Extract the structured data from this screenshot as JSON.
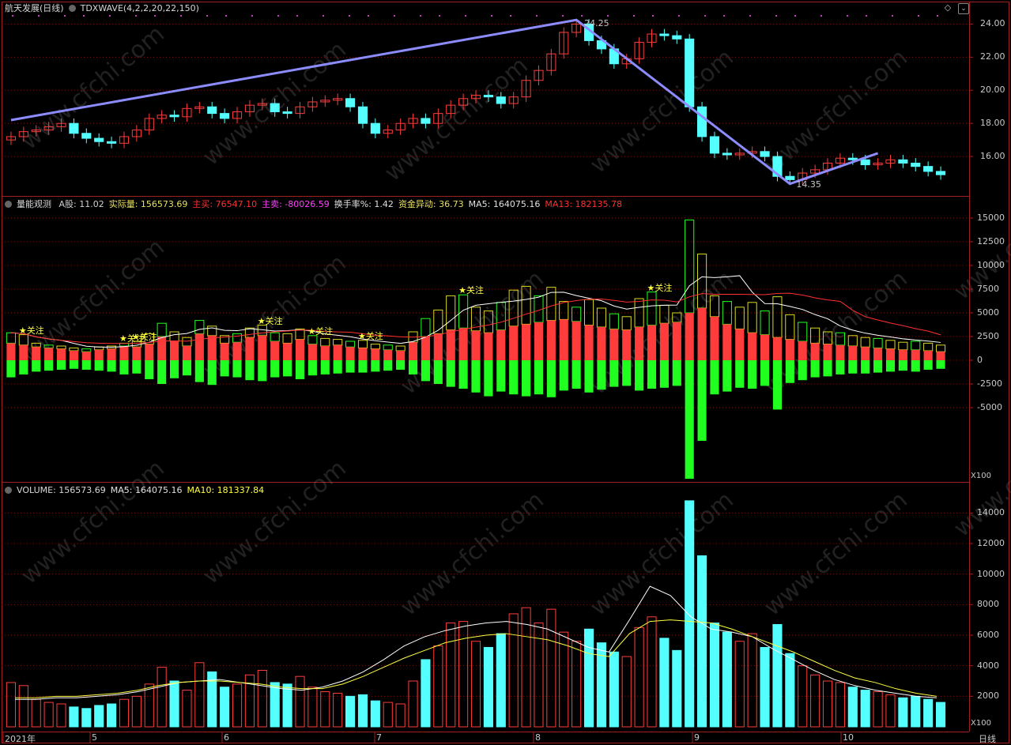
{
  "title": "航天发展(日线)",
  "indicator_name": "TDXWAVE(4,2,2,20,22,150)",
  "price_peak_label": "24.25",
  "price_trough_label": "14.35",
  "panel2": {
    "name": "量能观测",
    "items": [
      {
        "label": "A股: 11.02",
        "color": "#d0d0d0"
      },
      {
        "label": "实际量: 156573.69",
        "color": "#e8e060"
      },
      {
        "label": "主买: 76547.10",
        "color": "#ff3030"
      },
      {
        "label": "主卖: -80026.59",
        "color": "#ff40ff"
      },
      {
        "label": "换手率%: 1.42",
        "color": "#e0e0e0"
      },
      {
        "label": "资金异动: 36.73",
        "color": "#e8e060"
      },
      {
        "label": "MA5: 164075.16",
        "color": "#e0e0e0"
      },
      {
        "label": "MA13: 182135.78",
        "color": "#ff3030"
      }
    ],
    "marker": "关注",
    "unit": "X100"
  },
  "panel3": {
    "name": "VOLUME: 156573.69",
    "ma5": "MA5: 164075.16",
    "ma10": "MA10: 181337.84",
    "unit": "X100"
  },
  "period_label": "日线",
  "colors": {
    "up": "#ff3c3c",
    "down": "#54ffff",
    "wave": "#8c8cff",
    "ma5": "#ffffff",
    "ma10": "#ffff40",
    "ma13": "#ff3030",
    "green": "#20ff20"
  },
  "chart_data": [
    {
      "type": "candlestick",
      "title": "航天发展(日线)",
      "y_ticks": [
        "24.00",
        "22.00",
        "20.00",
        "18.00",
        "16.00"
      ],
      "ylim": [
        14.0,
        24.5
      ],
      "x_ticks": [
        "2021年",
        "5",
        "6",
        "7",
        "8",
        "9",
        "10"
      ],
      "peak": 24.25,
      "trough": 14.35,
      "close_path": [
        17.2,
        17.5,
        17.6,
        17.8,
        18.0,
        17.4,
        17.1,
        16.9,
        16.8,
        17.2,
        17.6,
        18.3,
        18.5,
        18.4,
        18.9,
        19.0,
        18.6,
        18.3,
        18.7,
        19.1,
        19.2,
        18.7,
        18.6,
        19.0,
        19.3,
        19.4,
        19.5,
        19.0,
        18.0,
        17.4,
        17.6,
        18.0,
        18.3,
        18.0,
        18.6,
        19.1,
        19.5,
        19.7,
        19.6,
        19.2,
        19.6,
        20.6,
        21.2,
        22.2,
        23.5,
        24.0,
        23.0,
        22.5,
        21.6,
        21.9,
        22.9,
        23.4,
        23.3,
        23.1,
        19.0,
        17.2,
        16.2,
        16.1,
        16.2,
        16.3,
        16.0,
        14.8,
        14.6,
        15.0,
        15.2,
        15.6,
        15.9,
        15.8,
        15.5,
        15.6,
        15.8,
        15.6,
        15.4,
        15.1,
        14.9
      ]
    },
    {
      "type": "bar",
      "title": "量能观测",
      "y_ticks": [
        "15000",
        "12500",
        "10000",
        "7500",
        "5000",
        "2500",
        "0",
        "-2500",
        "-5000"
      ],
      "ylim": [
        -12500,
        15000
      ],
      "series": [
        {
          "name": "主买",
          "values": [
            1800,
            1600,
            1400,
            1300,
            1200,
            1000,
            900,
            1100,
            1200,
            1500,
            1400,
            1700,
            2500,
            2000,
            1500,
            2800,
            2600,
            1800,
            1900,
            2400,
            2600,
            2000,
            1800,
            2200,
            1700,
            1500,
            1600,
            1400,
            1300,
            1200,
            1100,
            1000,
            1900,
            2500,
            2800,
            3200,
            3400,
            3100,
            2900,
            3200,
            3600,
            3800,
            4000,
            4200,
            4300,
            4100,
            3700,
            3500,
            3300,
            3200,
            3500,
            3700,
            3900,
            4000,
            5000,
            5500,
            4600,
            3800,
            3300,
            2900,
            2700,
            2400,
            2200,
            2000,
            1800,
            1700,
            1600,
            1500,
            1400,
            1300,
            1200,
            1100,
            1100,
            1000,
            900
          ]
        },
        {
          "name": "主卖",
          "values": [
            -1800,
            -1500,
            -1200,
            -1100,
            -1000,
            -900,
            -1000,
            -1100,
            -1200,
            -1500,
            -1400,
            -2000,
            -2500,
            -1900,
            -1600,
            -2300,
            -2600,
            -1700,
            -1800,
            -2100,
            -2200,
            -1800,
            -1700,
            -2000,
            -1600,
            -1500,
            -1400,
            -1300,
            -1300,
            -1200,
            -1100,
            -1000,
            -1500,
            -2200,
            -2500,
            -2800,
            -3000,
            -3400,
            -3800,
            -3300,
            -3600,
            -3800,
            -3600,
            -3900,
            -3200,
            -3000,
            -3400,
            -3100,
            -2800,
            -2700,
            -3200,
            -3000,
            -2900,
            -2700,
            -12500,
            -8500,
            -3600,
            -3300,
            -2900,
            -3000,
            -2700,
            -5200,
            -2400,
            -2100,
            -1800,
            -1700,
            -1500,
            -1400,
            -1400,
            -1300,
            -1200,
            -1100,
            -1200,
            -1000,
            -900
          ]
        }
      ]
    },
    {
      "type": "bar",
      "title": "VOLUME",
      "y_ticks": [
        "14000",
        "12000",
        "10000",
        "8000",
        "6000",
        "4000",
        "2000"
      ],
      "ylim": [
        0,
        15000
      ],
      "series": [
        {
          "name": "VOLUME",
          "values": [
            2900,
            2700,
            1800,
            1600,
            1500,
            1300,
            1200,
            1400,
            1500,
            1800,
            2000,
            2800,
            3900,
            3000,
            2400,
            4200,
            3600,
            2600,
            2800,
            3400,
            3700,
            2900,
            2800,
            3300,
            2600,
            2300,
            2200,
            2000,
            2100,
            1700,
            1600,
            1500,
            3000,
            4400,
            5300,
            6800,
            6900,
            5600,
            5200,
            6100,
            7400,
            7800,
            6800,
            7700,
            6200,
            5600,
            6400,
            5500,
            4900,
            4600,
            6500,
            7200,
            5800,
            5000,
            14800,
            11200,
            6800,
            6200,
            5600,
            6100,
            5200,
            6700,
            4800,
            4000,
            3400,
            3000,
            2900,
            2600,
            2400,
            2300,
            2100,
            1900,
            2000,
            1800,
            1600
          ]
        },
        {
          "name": "MA5",
          "values": [
            1800,
            1800,
            1900,
            1900,
            2000,
            2100,
            2300,
            2600,
            2900,
            3000,
            3100,
            2900,
            2700,
            2500,
            2400,
            2600,
            3000,
            3600,
            4400,
            5300,
            5900,
            6300,
            6600,
            6800,
            6900,
            6700,
            6400,
            5800,
            5200,
            4900,
            7000,
            9200,
            8600,
            7200,
            6400,
            6200,
            5900,
            5100,
            4400,
            3700,
            3100,
            2700,
            2400,
            2200,
            2000,
            1900
          ]
        },
        {
          "name": "MA10",
          "values": [
            1900,
            1900,
            2000,
            2000,
            2100,
            2200,
            2400,
            2700,
            2900,
            3000,
            3000,
            2900,
            2800,
            2600,
            2500,
            2500,
            2800,
            3300,
            3900,
            4500,
            5000,
            5500,
            5800,
            6000,
            6100,
            5900,
            5700,
            5300,
            4800,
            4600,
            6100,
            6900,
            7000,
            6900,
            6800,
            6400,
            5900,
            5400,
            4900,
            4300,
            3700,
            3200,
            2900,
            2500,
            2200,
            2000
          ]
        }
      ]
    }
  ]
}
